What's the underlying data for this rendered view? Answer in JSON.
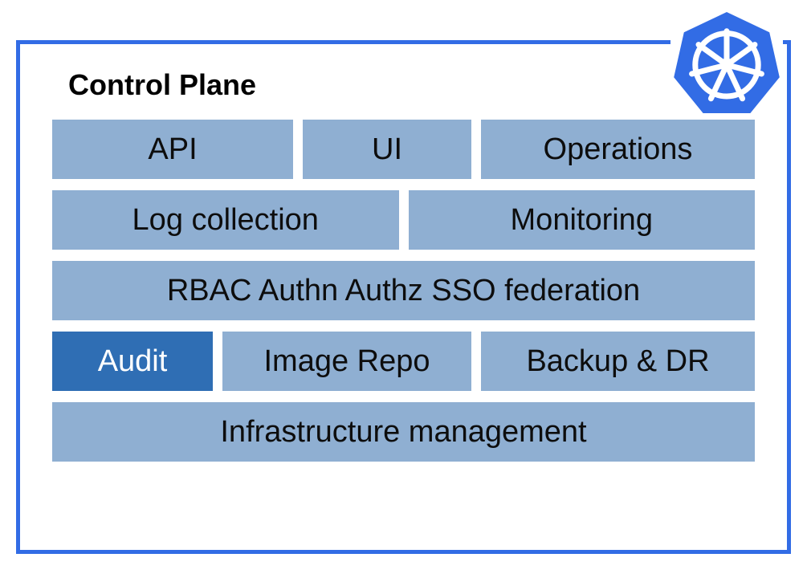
{
  "title": "Control Plane",
  "icon": "kubernetes-logo",
  "colors": {
    "frame_border": "#326CE5",
    "block_bg": "#8FAFD2",
    "block_accent": "#2F6EB4",
    "text": "#111111"
  },
  "rows": [
    {
      "blocks": [
        {
          "key": "api",
          "label": "API",
          "accent": false
        },
        {
          "key": "ui",
          "label": "UI",
          "accent": false
        },
        {
          "key": "ops",
          "label": "Operations",
          "accent": false
        }
      ]
    },
    {
      "blocks": [
        {
          "key": "logs",
          "label": "Log collection",
          "accent": false
        },
        {
          "key": "mon",
          "label": "Monitoring",
          "accent": false
        }
      ]
    },
    {
      "blocks": [
        {
          "key": "rbac",
          "label": "RBAC Authn Authz SSO federation",
          "accent": false
        }
      ]
    },
    {
      "blocks": [
        {
          "key": "audit",
          "label": "Audit",
          "accent": true
        },
        {
          "key": "repo",
          "label": "Image Repo",
          "accent": false
        },
        {
          "key": "bdr",
          "label": "Backup & DR",
          "accent": false
        }
      ]
    },
    {
      "blocks": [
        {
          "key": "infra",
          "label": "Infrastructure management",
          "accent": false
        }
      ]
    }
  ]
}
